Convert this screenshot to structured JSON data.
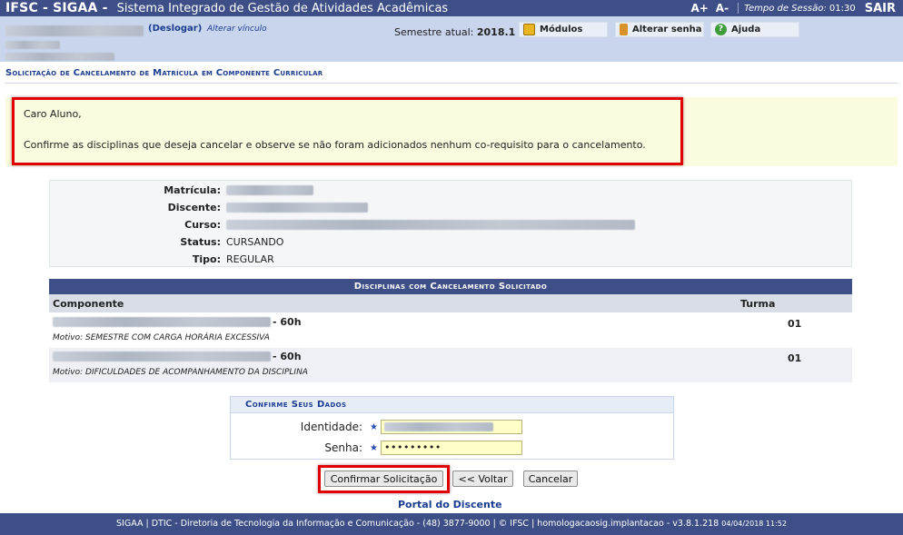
{
  "topbar": {
    "brand": "IFSC - SIGAA -",
    "system_name": "Sistema Integrado de Gestão de Atividades Acadêmicas",
    "font_increase": "A+",
    "font_decrease": "A-",
    "session_label": "Tempo de Sessão:",
    "session_time": "01:30",
    "logout": "SAIR"
  },
  "userbar": {
    "deslogar": "(Deslogar)",
    "alterar_vinculo": "Alterar vínculo",
    "semestre_label": "Semestre atual:",
    "semestre_value": "2018.1",
    "menu": {
      "modulos": "Módulos",
      "alterar_senha": "Alterar senha",
      "ajuda": "Ajuda"
    }
  },
  "page_title": "Solicitação de Cancelamento de Matrícula em Componente Curricular",
  "message": {
    "greeting": "Caro Aluno,",
    "text": "Confirme as disciplinas que deseja cancelar e observe se não foram adicionados nenhum co-requisito para o cancelamento."
  },
  "student": {
    "matricula_label": "Matrícula:",
    "discente_label": "Discente:",
    "curso_label": "Curso:",
    "status_label": "Status:",
    "status_value": "CURSANDO",
    "tipo_label": "Tipo:",
    "tipo_value": "REGULAR"
  },
  "disciplinas": {
    "header": "Disciplinas com Cancelamento Solicitado",
    "col_componente": "Componente",
    "col_turma": "Turma",
    "rows": [
      {
        "hours": "- 60h",
        "turma": "01",
        "motivo": "Motivo: SEMESTRE COM CARGA HORÁRIA EXCESSIVA"
      },
      {
        "hours": "- 60h",
        "turma": "01",
        "motivo": "Motivo: DIFICULDADES DE ACOMPANHAMENTO DA DISCIPLINA"
      }
    ]
  },
  "confirm": {
    "header": "Confirme Seus Dados",
    "identidade_label": "Identidade:",
    "senha_label": "Senha:",
    "senha_value": "•••••••••"
  },
  "buttons": {
    "confirmar": "Confirmar Solicitação",
    "voltar": "<< Voltar",
    "cancelar": "Cancelar"
  },
  "portal_link": "Portal do Discente",
  "footer": {
    "text": "SIGAA | DTIC - Diretoria de Tecnologia da Informação e Comunicação - (48) 3877-9000 | © IFSC | homologacaosig.implantacao - v3.8.1.218",
    "timestamp": "04/04/2018 11:52"
  },
  "colors": {
    "navy": "#3d4f86",
    "light_blue": "#c8d5ec",
    "highlight_red": "#e00000",
    "message_bg": "#fbfbe0",
    "input_bg": "#ffffc8"
  }
}
